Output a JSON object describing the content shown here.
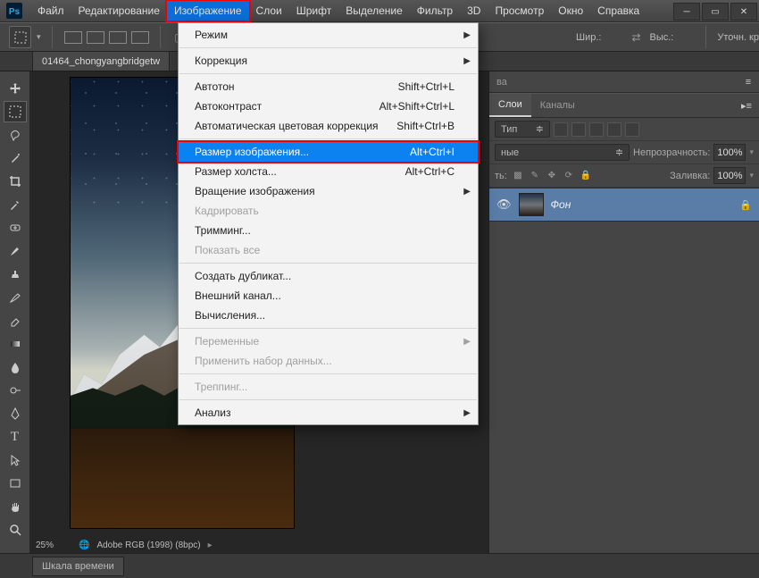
{
  "menubar": {
    "items": [
      "Файл",
      "Редактирование",
      "Изображение",
      "Слои",
      "Шрифт",
      "Выделение",
      "Фильтр",
      "3D",
      "Просмотр",
      "Окно",
      "Справка"
    ],
    "active_index": 2
  },
  "optionsbar": {
    "width_label": "Шир.:",
    "width_value": "",
    "swap": "⇄",
    "height_label": "Выс.:",
    "height_value": "",
    "refine_label": "Уточн. кр"
  },
  "document_tab": "01464_chongyangbridgetw",
  "status": {
    "zoom": "25%",
    "profile": "Adobe RGB (1998) (8bpc)"
  },
  "right_panel": {
    "truncated_tab": "ва",
    "tabs": [
      "Слои",
      "Каналы"
    ],
    "active_tab_index": 0,
    "filter_kind": "Тип",
    "blend_mode": "ные",
    "opacity_label": "Непрозрачность:",
    "opacity_value": "100%",
    "lock_label": "ть:",
    "fill_label": "Заливка:",
    "fill_value": "100%",
    "layer_name": "Фон"
  },
  "timeline_tab": "Шкала времени",
  "dropdown": {
    "items": [
      {
        "type": "item",
        "label": "Режим",
        "submenu": true
      },
      {
        "type": "sep"
      },
      {
        "type": "item",
        "label": "Коррекция",
        "submenu": true
      },
      {
        "type": "sep"
      },
      {
        "type": "item",
        "label": "Автотон",
        "shortcut": "Shift+Ctrl+L"
      },
      {
        "type": "item",
        "label": "Автоконтраст",
        "shortcut": "Alt+Shift+Ctrl+L"
      },
      {
        "type": "item",
        "label": "Автоматическая цветовая коррекция",
        "shortcut": "Shift+Ctrl+B"
      },
      {
        "type": "sep"
      },
      {
        "type": "item",
        "label": "Размер изображения...",
        "shortcut": "Alt+Ctrl+I",
        "selected": true
      },
      {
        "type": "item",
        "label": "Размер холста...",
        "shortcut": "Alt+Ctrl+C"
      },
      {
        "type": "item",
        "label": "Вращение изображения",
        "submenu": true
      },
      {
        "type": "item",
        "label": "Кадрировать",
        "disabled": true
      },
      {
        "type": "item",
        "label": "Тримминг..."
      },
      {
        "type": "item",
        "label": "Показать все",
        "disabled": true
      },
      {
        "type": "sep"
      },
      {
        "type": "item",
        "label": "Создать дубликат..."
      },
      {
        "type": "item",
        "label": "Внешний канал..."
      },
      {
        "type": "item",
        "label": "Вычисления..."
      },
      {
        "type": "sep"
      },
      {
        "type": "item",
        "label": "Переменные",
        "submenu": true,
        "disabled": true
      },
      {
        "type": "item",
        "label": "Применить набор данных...",
        "disabled": true
      },
      {
        "type": "sep"
      },
      {
        "type": "item",
        "label": "Треппинг...",
        "disabled": true
      },
      {
        "type": "sep"
      },
      {
        "type": "item",
        "label": "Анализ",
        "submenu": true
      }
    ]
  }
}
